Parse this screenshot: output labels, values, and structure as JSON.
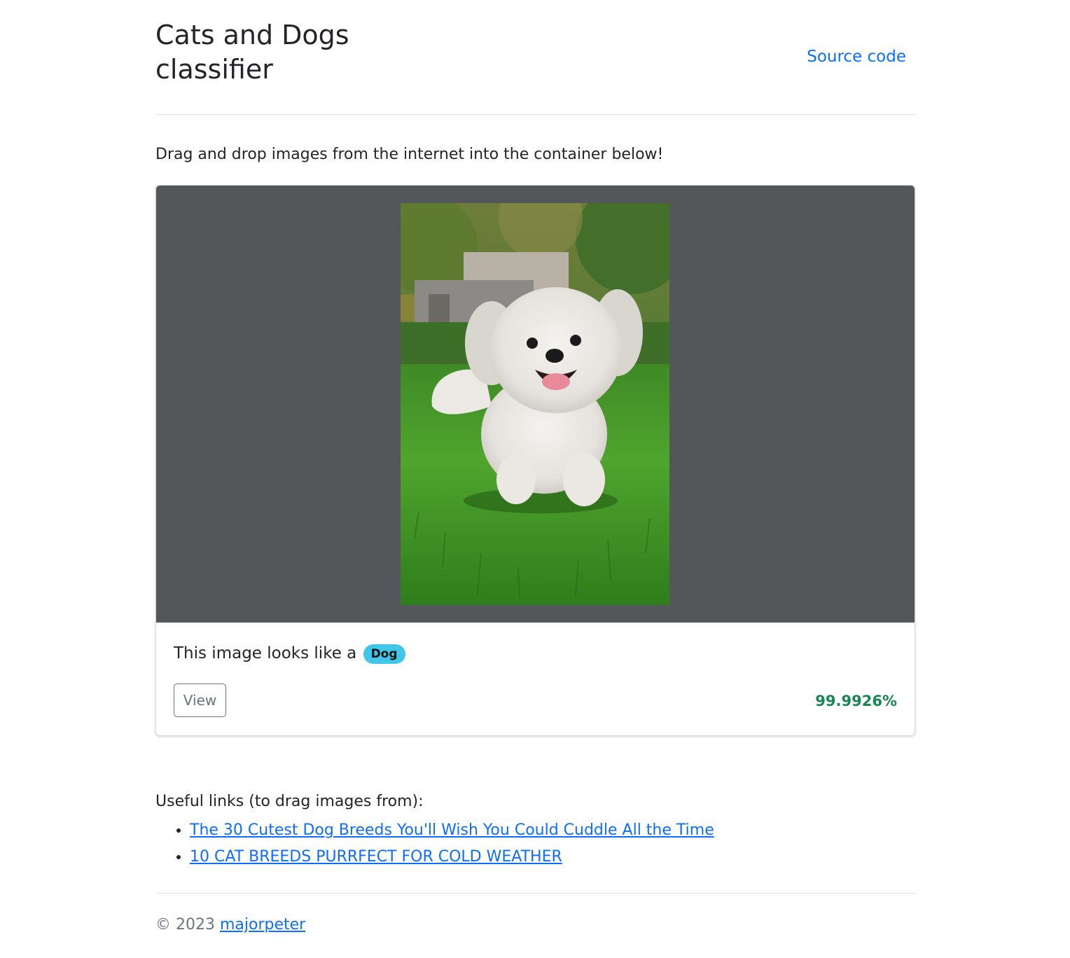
{
  "header": {
    "title": "Cats and Dogs classifier",
    "source_link": "Source code"
  },
  "intro_text": "Drag and drop images from the internet into the container below!",
  "result_card": {
    "image_description": "white fluffy dog running on grass",
    "caption_prefix": "This image looks like a",
    "label_badge": "Dog",
    "view_button": "View",
    "confidence": "99.9926%"
  },
  "useful_links": {
    "heading": "Useful links (to drag images from):",
    "items": [
      "The 30 Cutest Dog Breeds You'll Wish You Could Cuddle All the Time",
      "10 CAT BREEDS PURRFECT FOR COLD WEATHER"
    ]
  },
  "footer": {
    "copyright": "© 2023",
    "author_link": "majorpeter"
  },
  "colors": {
    "link": "#0d6efd",
    "badge": "#3fc7ea",
    "success": "#198754",
    "image_area_bg": "#53575a"
  }
}
